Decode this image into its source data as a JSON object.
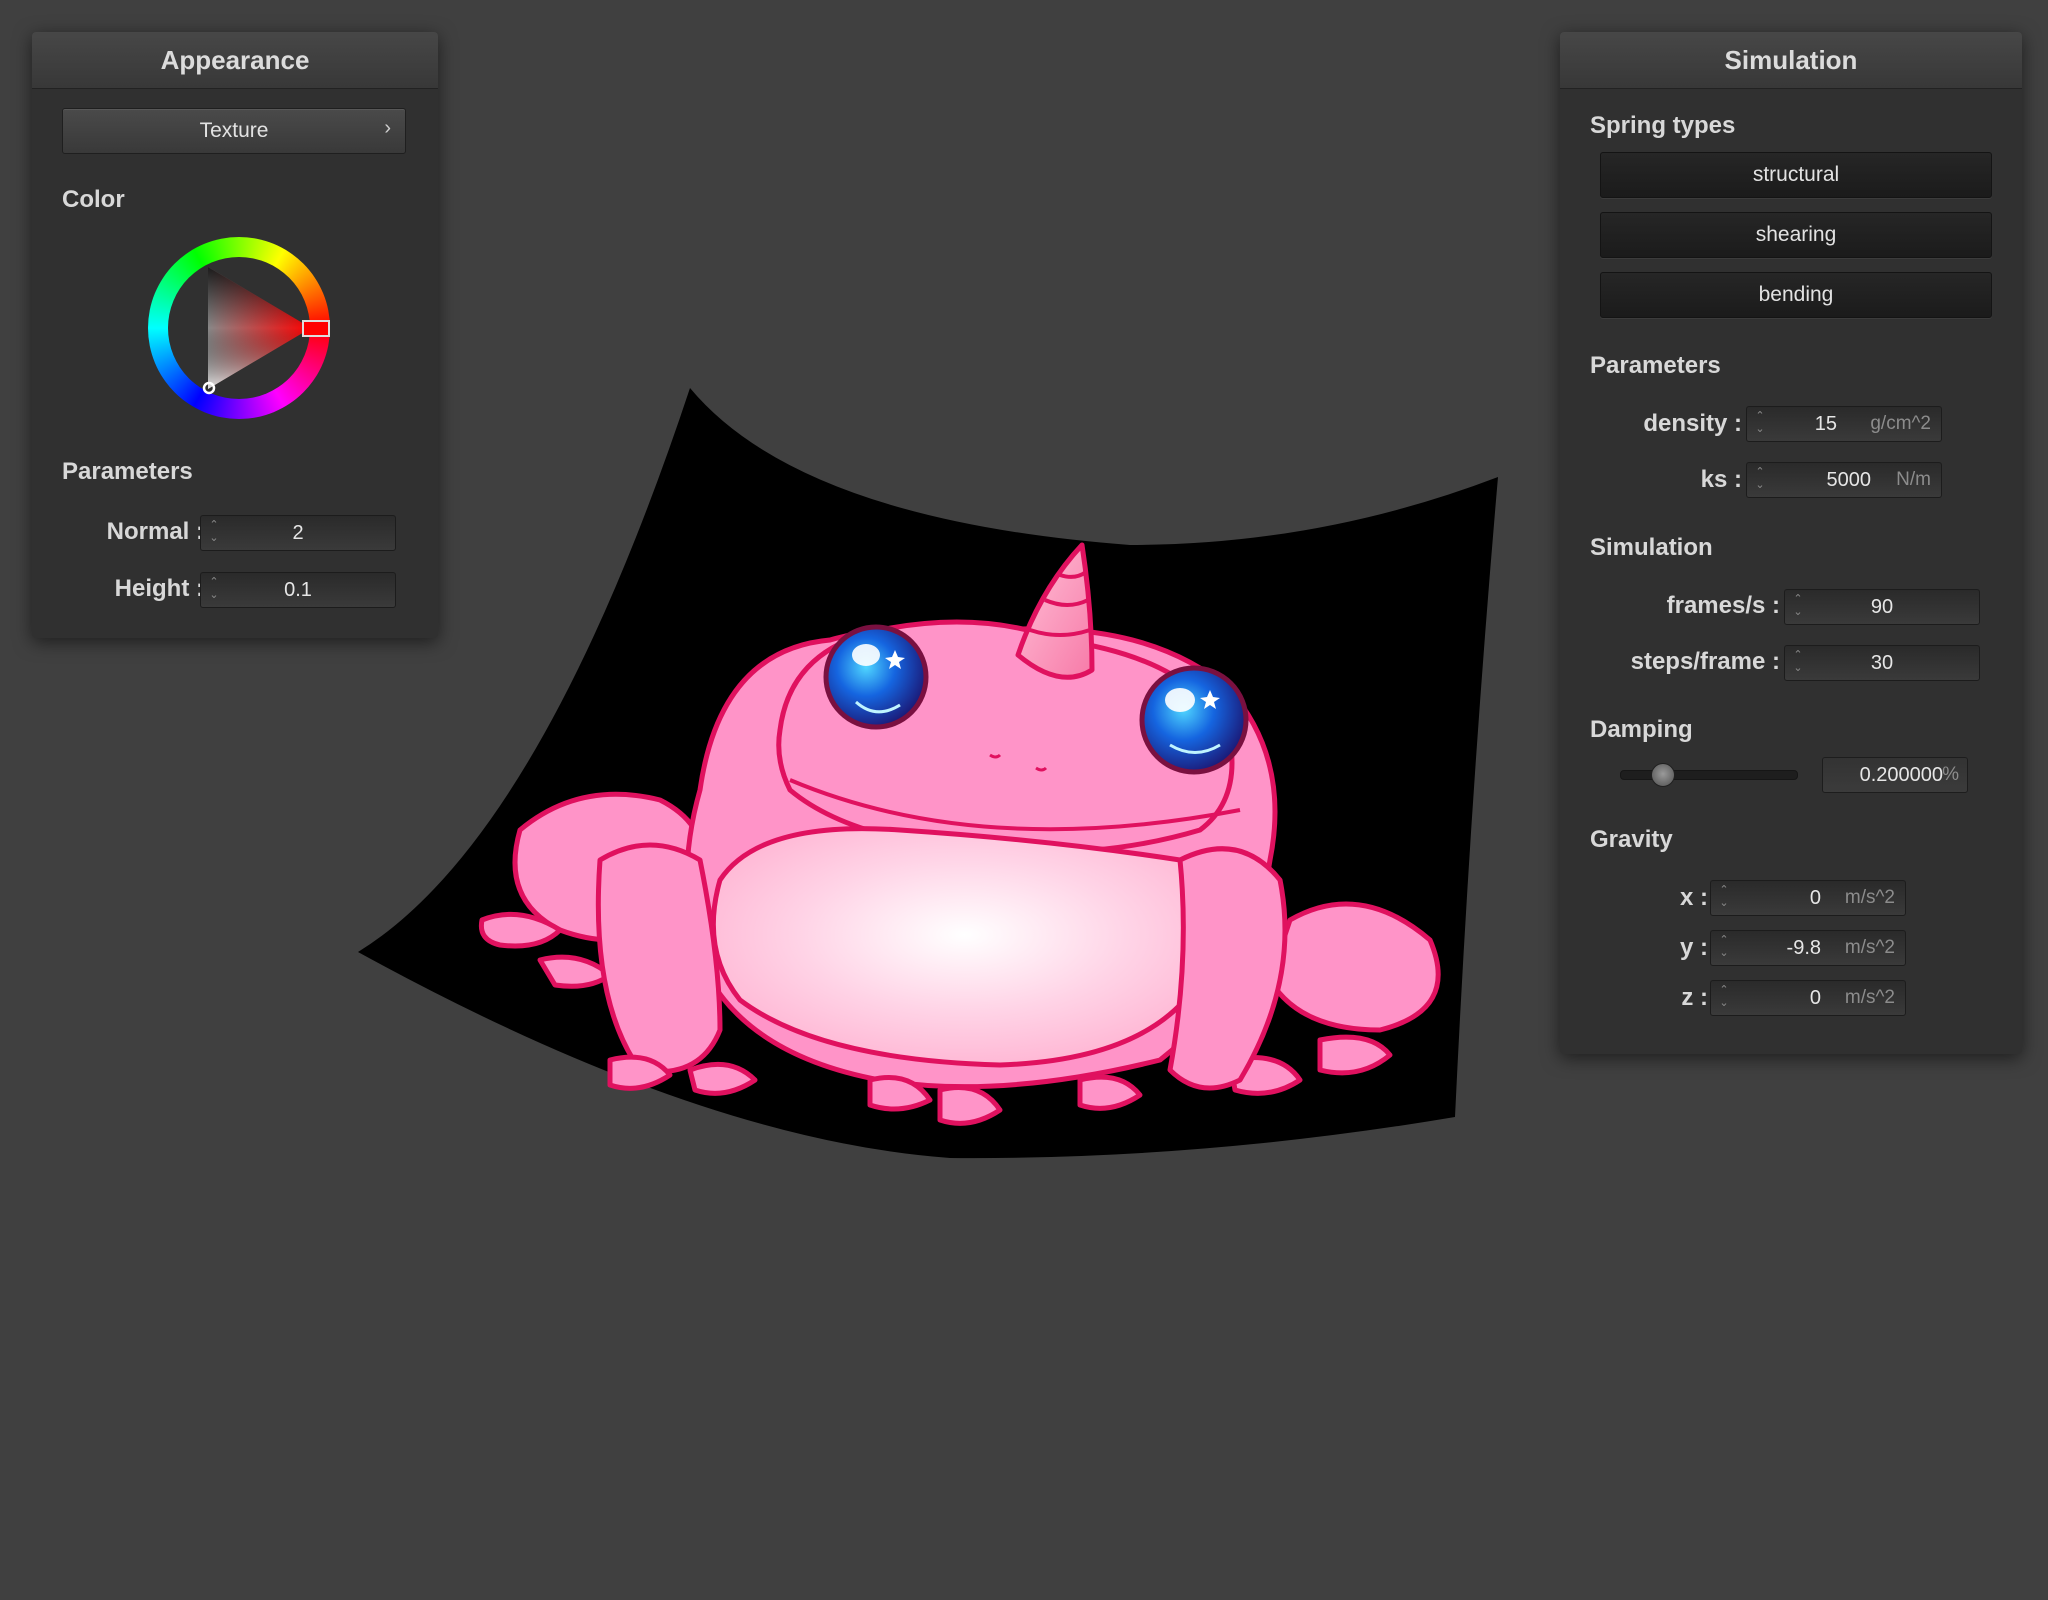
{
  "appearance": {
    "title": "Appearance",
    "texture_button": "Texture",
    "texture_chevron": "›",
    "color_label": "Color",
    "parameters_label": "Parameters",
    "normal": {
      "label": "Normal :",
      "value": "2"
    },
    "height": {
      "label": "Height :",
      "value": "0.1"
    }
  },
  "simulation": {
    "title": "Simulation",
    "spring_types_label": "Spring types",
    "spring_types": [
      "structural",
      "shearing",
      "bending"
    ],
    "parameters_label": "Parameters",
    "density": {
      "label": "density :",
      "value": "15",
      "unit": "g/cm^2"
    },
    "ks": {
      "label": "ks :",
      "value": "5000",
      "unit": "N/m"
    },
    "simulation_label": "Simulation",
    "frames_per_s": {
      "label": "frames/s :",
      "value": "90"
    },
    "steps_per_frame": {
      "label": "steps/frame :",
      "value": "30"
    },
    "damping_label": "Damping",
    "damping": {
      "value": "0.200000",
      "unit": "%",
      "slider_fraction": 0.2
    },
    "gravity_label": "Gravity",
    "gravity": {
      "x": {
        "label": "x :",
        "value": "0",
        "unit": "m/s^2"
      },
      "y": {
        "label": "y :",
        "value": "-9.8",
        "unit": "m/s^2"
      },
      "z": {
        "label": "z :",
        "value": "0",
        "unit": "m/s^2"
      }
    }
  },
  "colors": {
    "background": "#404040",
    "panel": "#303030",
    "cloth": "#000000",
    "frog_pink": "#ff94c8",
    "frog_outline": "#e0115f",
    "eye_blue": "#1e6fe0",
    "selected_color": "#ff0000"
  },
  "icons": {
    "spinner": "up-down-arrows-icon",
    "chevron": "chevron-right-icon"
  }
}
